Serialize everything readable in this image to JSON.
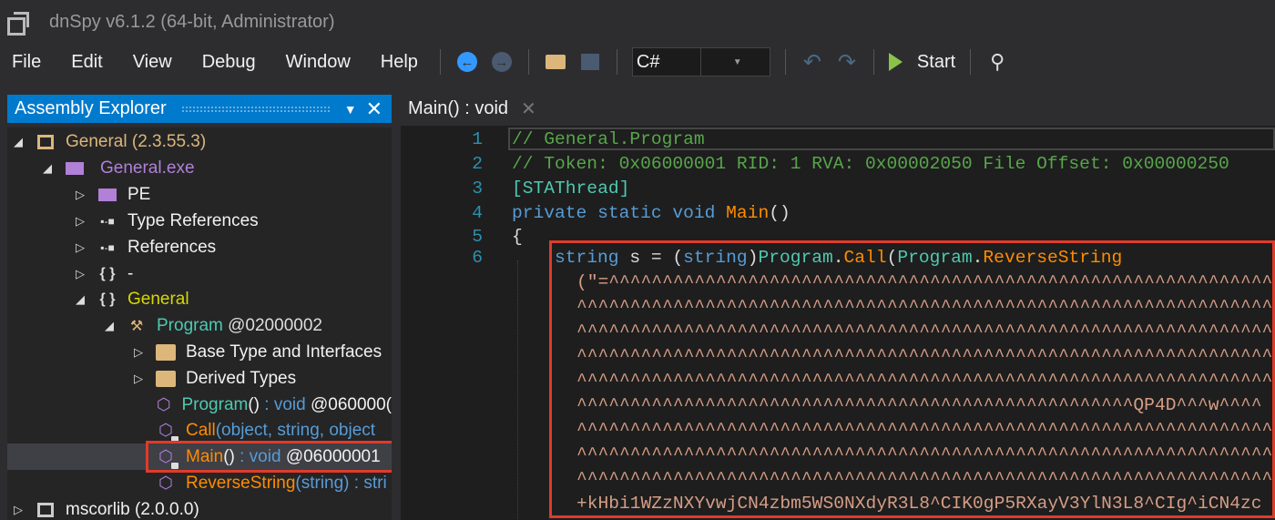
{
  "window": {
    "title": "dnSpy v6.1.2 (64-bit, Administrator)"
  },
  "menu": [
    "File",
    "Edit",
    "View",
    "Debug",
    "Window",
    "Help"
  ],
  "toolbar": {
    "language": "C#",
    "start_label": "Start"
  },
  "assembly_explorer": {
    "title": "Assembly Explorer",
    "items": [
      {
        "label": "General (2.3.55.3)",
        "color": "#dcb67a"
      },
      {
        "label": "General.exe",
        "color": "#b180d7"
      },
      {
        "label": "PE",
        "color": "#f1f1f1"
      },
      {
        "label": "Type References",
        "color": "#f1f1f1"
      },
      {
        "label": "References",
        "color": "#f1f1f1"
      },
      {
        "label": "-",
        "color": "#f1f1f1"
      },
      {
        "label": "General",
        "color": "#d7d700"
      },
      {
        "label": "Program",
        "suffix": " @02000002"
      },
      {
        "label": "Base Type and Interfaces"
      },
      {
        "label": "Derived Types"
      },
      {
        "name": "Program",
        "args": "()",
        " sep": "",
        "ret": " : void",
        "token": " @060000("
      },
      {
        "name": "Call",
        "args": "(object, string, object"
      },
      {
        "name": "Main",
        "args": "()",
        "ret": " : void",
        "token": " @06000001"
      },
      {
        "name": "ReverseString",
        "args": "(string)",
        "ret": " : stri"
      },
      {
        "label": "mscorlib (2.0.0.0)"
      }
    ]
  },
  "editor": {
    "tab_label": "Main() : void",
    "line_numbers": [
      "1",
      "2",
      "3",
      "4",
      "5",
      "6"
    ],
    "lines": {
      "l1": "// General.Program",
      "l2": "// Token: 0x06000001 RID: 1 RVA: 0x00002050 File Offset: 0x00000250",
      "l3": "[STAThread]",
      "l4a": "private static void ",
      "l4b": "Main",
      "l4c": "()",
      "l5": "{",
      "l6a": "string",
      "l6b": " s = (",
      "l6c": "string",
      "l6d": ")",
      "l6e": "Program",
      "l6f": ".",
      "l6g": "Call",
      "l6h": "(",
      "l6i": "Program",
      "l6j": ".",
      "l6k": "ReverseString"
    },
    "string_lines": [
      "(\"=^^^^^^^^^^^^^^^^^^^^^^^^^^^^^^^^^^^^^^^^^^^^^^^^^^^^^^^^^^^^^^^^",
      "^^^^^^^^^^^^^^^^^^^^^^^^^^^^^^^^^^^^^^^^^^^^^^^^^^^^^^^^^^^^^^^^^^",
      "^^^^^^^^^^^^^^^^^^^^^^^^^^^^^^^^^^^^^^^^^^^^^^^^^^^^^^^^^^^^^^^^^^",
      "^^^^^^^^^^^^^^^^^^^^^^^^^^^^^^^^^^^^^^^^^^^^^^^^^^^^^^^^^^^^^^^^^^",
      "^^^^^^^^^^^^^^^^^^^^^^^^^^^^^^^^^^^^^^^^^^^^^^^^^^^^^^^^^^^^^^^^^^",
      "^^^^^^^^^^^^^^^^^^^^^^^^^^^^^^^^^^^^^^^^^^^^^^^^^^^^QP4D^^^w^^^^",
      "^^^^^^^^^^^^^^^^^^^^^^^^^^^^^^^^^^^^^^^^^^^^^^^^^^^^^^^^^^^^^^^^^^",
      "^^^^^^^^^^^^^^^^^^^^^^^^^^^^^^^^^^^^^^^^^^^^^^^^^^^^^^^^^^^^^^^^^^",
      "^^^^^^^^^^^^^^^^^^^^^^^^^^^^^^^^^^^^^^^^^^^^^^^^^^^^^^^^^^^^^^^^^^",
      "+kHbi1WZzNXYvwjCN4zbm5WS0NXdyR3L8^CIK0gP5RXayV3YlN3L8^CIg^iCN4zc"
    ]
  },
  "colors": {
    "accent": "#007acc",
    "highlight_box": "#e03b2a"
  }
}
